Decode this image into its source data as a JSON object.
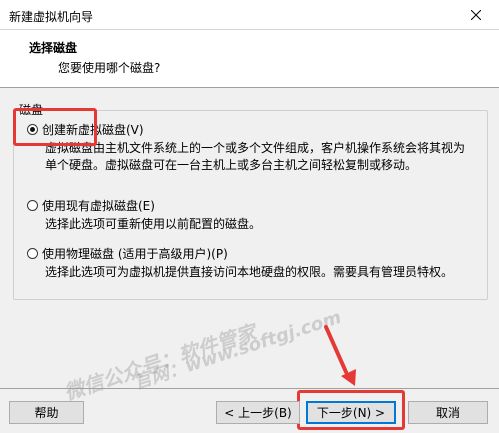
{
  "window": {
    "title": "新建虚拟机向导"
  },
  "header": {
    "title": "选择磁盘",
    "subtitle": "您要使用哪个磁盘?"
  },
  "group": {
    "label": "磁盘"
  },
  "options": [
    {
      "label": "创建新虚拟磁盘(V)",
      "checked": true,
      "description": [
        "虚拟磁盘由主机文件系统上的一个或多个文件组成，客户机操作系统会将其视为",
        "单个硬盘。虚拟磁盘可在一台主机上或多台主机之间轻松复制或移动。"
      ]
    },
    {
      "label": "使用现有虚拟磁盘(E)",
      "checked": false,
      "description": [
        "选择此选项可重新使用以前配置的磁盘。"
      ]
    },
    {
      "label": "使用物理磁盘 (适用于高级用户)(P)",
      "checked": false,
      "description": [
        "选择此选项可为虚拟机提供直接访问本地硬盘的权限。需要具有管理员特权。"
      ]
    }
  ],
  "watermark": {
    "line1": "微信公众号：软件管家",
    "line2": "官网：www.softgj.com"
  },
  "buttons": {
    "help": "帮助",
    "back": "< 上一步(B)",
    "next": "下一步(N) >",
    "cancel": "取消"
  },
  "colors": {
    "highlight": "#e53935",
    "accent": "#0078d7"
  }
}
